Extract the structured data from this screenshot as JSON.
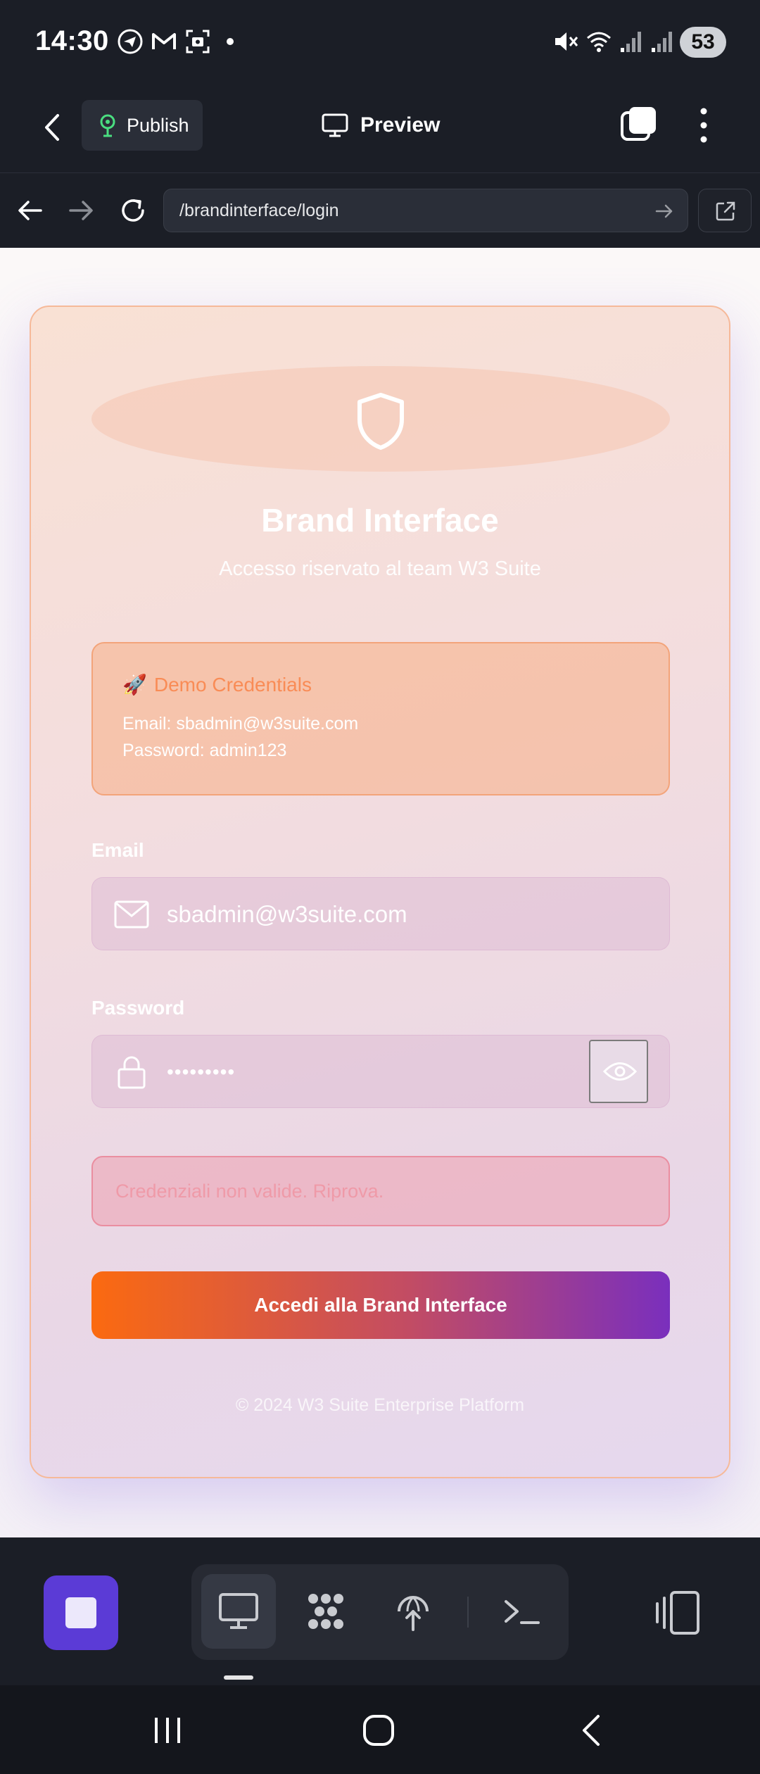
{
  "status_bar": {
    "time": "14:30",
    "icons": [
      "telegram-icon",
      "gmail-icon",
      "screenshot-icon",
      "notification-dot",
      "mute-icon",
      "wifi-icon",
      "signal-icon",
      "signal-icon-2"
    ],
    "battery": "53"
  },
  "app_bar": {
    "publish_label": "Publish",
    "preview_label": "Preview"
  },
  "browser": {
    "url": "/brandinterface/login"
  },
  "login_card": {
    "title": "Brand Interface",
    "subtitle": "Accesso riservato al team W3 Suite",
    "demo": {
      "icon": "🚀",
      "title": "Demo Credentials",
      "email_line": "Email: sbadmin@w3suite.com",
      "password_line": "Password: admin123"
    },
    "email_label": "Email",
    "email_value": "sbadmin@w3suite.com",
    "password_label": "Password",
    "password_value": "•••••••••",
    "error": "Credenziali non valide. Riprova.",
    "submit_label": "Accedi alla Brand Interface",
    "footer": "© 2024 W3 Suite Enterprise Platform"
  },
  "colors": {
    "accent_orange": "#fb6a10",
    "accent_purple": "#7a2fbd",
    "stop_button": "#5b3bd6",
    "publish_icon": "#4ade80"
  },
  "toolbar": {
    "icons": [
      "stop-icon",
      "monitor-icon",
      "agents-icon",
      "deploy-icon",
      "terminal-icon",
      "devices-icon"
    ]
  }
}
